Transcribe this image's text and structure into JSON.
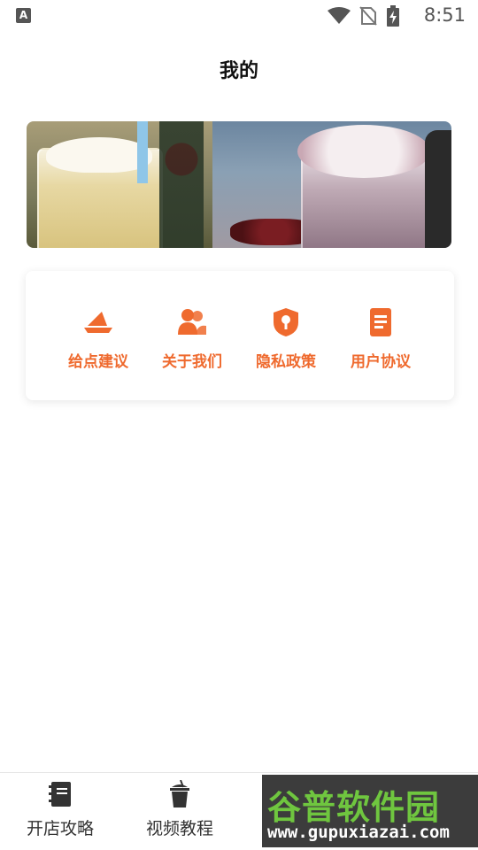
{
  "status_bar": {
    "left_badge": "A",
    "time": "8:51",
    "icons": [
      "wifi-icon",
      "no-sim-icon",
      "battery-charging-icon"
    ]
  },
  "header": {
    "title": "我的"
  },
  "menu": {
    "items": [
      {
        "label": "给点建议",
        "icon": "feedback-icon"
      },
      {
        "label": "关于我们",
        "icon": "users-icon"
      },
      {
        "label": "隐私政策",
        "icon": "shield-lock-icon"
      },
      {
        "label": "用户协议",
        "icon": "document-icon"
      }
    ],
    "accent_color": "#ef6a2e"
  },
  "bottom_nav": {
    "items": [
      {
        "label": "开店攻略",
        "icon": "notebook-icon"
      },
      {
        "label": "视频教程",
        "icon": "cup-icon"
      }
    ]
  },
  "watermark": {
    "title": "谷普软件园",
    "url": "www.gupuxiazai.com"
  }
}
